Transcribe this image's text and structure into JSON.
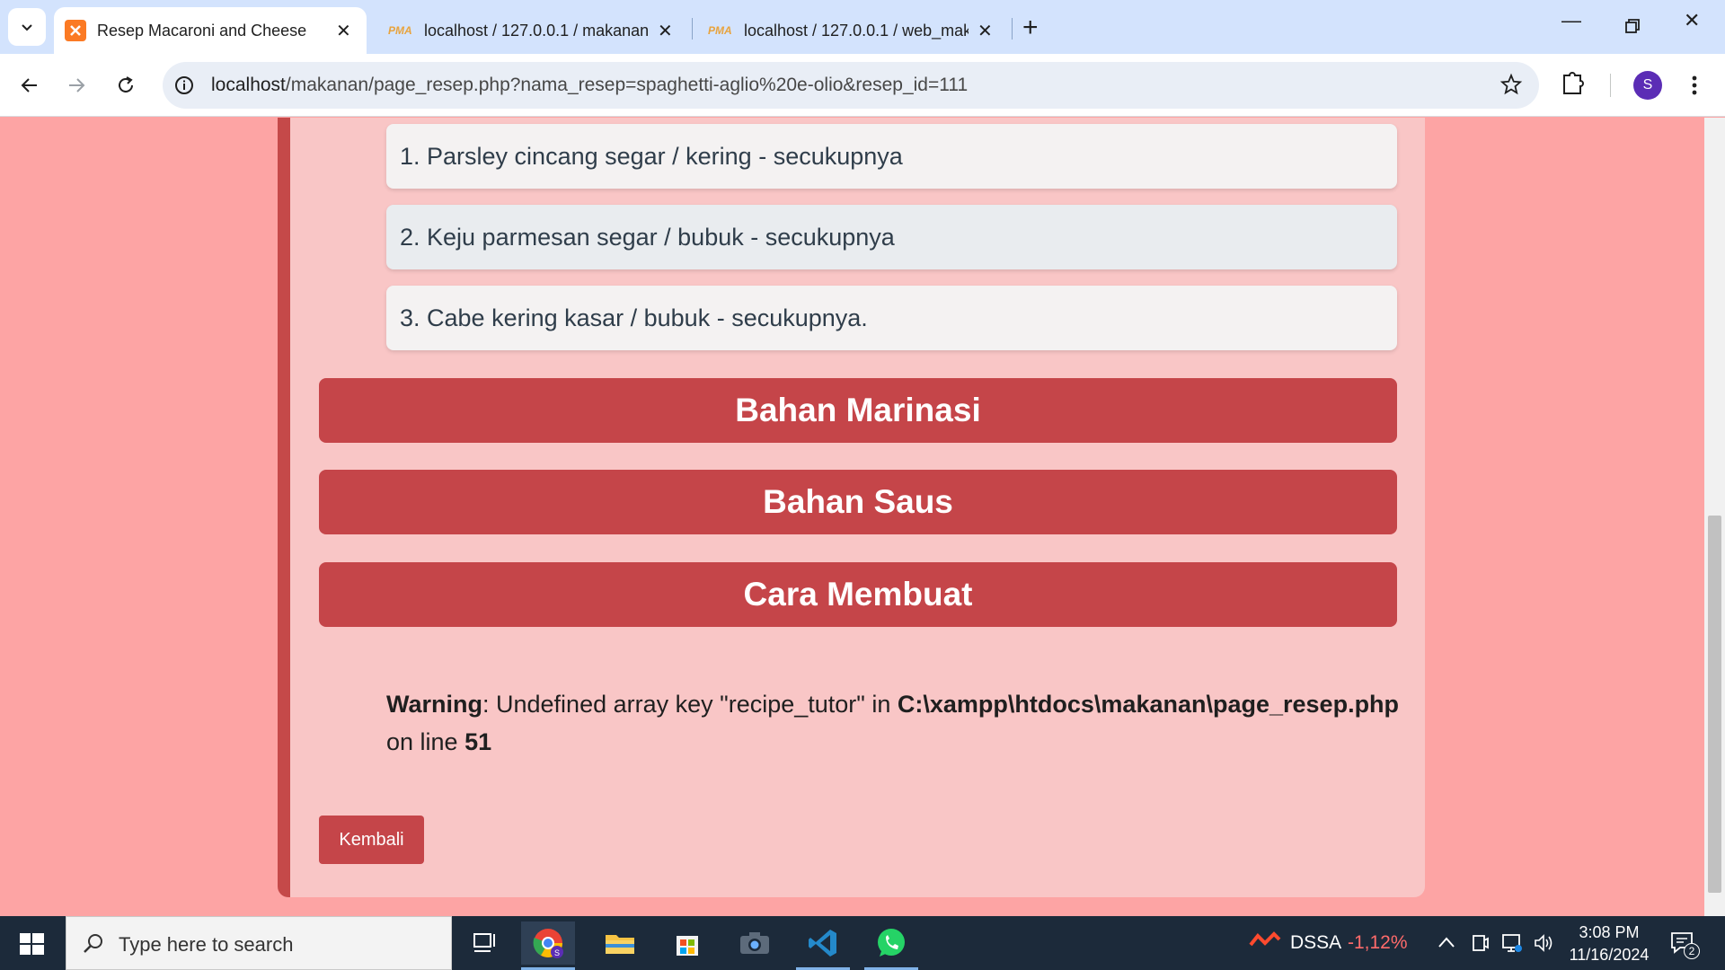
{
  "browser": {
    "tabs": [
      {
        "title": "Resep Macaroni and Cheese",
        "active": true,
        "favicon": "xampp-icon"
      },
      {
        "title": "localhost / 127.0.0.1 / makanan",
        "active": false,
        "favicon": "pma-icon"
      },
      {
        "title": "localhost / 127.0.0.1 / web_mak",
        "active": false,
        "favicon": "pma-icon"
      }
    ],
    "favicon_text": "PMA",
    "address": {
      "host": "localhost",
      "path": "/makanan/page_resep.php?nama_resep=spaghetti-aglio%20e-olio&resep_id=111"
    },
    "profile_initial": "S"
  },
  "page": {
    "ingredients": [
      "1. Parsley cincang segar / kering - secukupnya",
      "2. Keju parmesan segar / bubuk - secukupnya",
      "3. Cabe kering kasar / bubuk - secukupnya."
    ],
    "sections": [
      "Bahan Marinasi",
      "Bahan Saus",
      "Cara Membuat"
    ],
    "warning": {
      "label": "Warning",
      "message_before": ": Undefined array key \"recipe_tutor\" in ",
      "file": "C:\\xampp\\htdocs\\makanan\\page_resep.php",
      "message_after": " on line ",
      "line": "51"
    },
    "back_label": "Kembali"
  },
  "taskbar": {
    "search_placeholder": "Type here to search",
    "stock_name": "DSSA",
    "stock_change": "-1,12%",
    "time": "3:08 PM",
    "date": "11/16/2024",
    "notification_count": "2"
  },
  "colors": {
    "page_bg": "#fda4a4",
    "card_bg": "#f9c6c6",
    "accent": "#c54549",
    "stock_negative": "#ff6b6b"
  }
}
